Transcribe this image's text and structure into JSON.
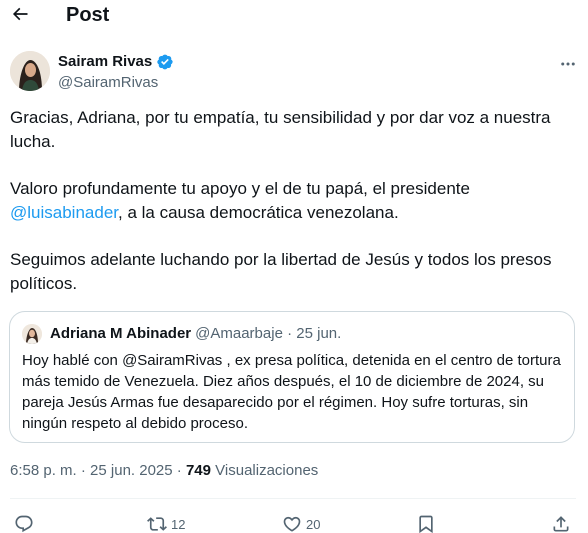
{
  "header": {
    "title": "Post"
  },
  "author": {
    "name": "Sairam Rivas",
    "handle": "@SairamRivas"
  },
  "tweet": {
    "p1": "Gracias, Adriana, por tu empatía, tu sensibilidad y por dar voz a nuestra lucha.",
    "p2_before": "Valoro profundamente tu apoyo y el de tu papá, el presidente ",
    "p2_mention": "@luisabinader",
    "p2_after": ", a la causa democrática venezolana.",
    "p3": "Seguimos adelante luchando por la libertad de Jesús y todos los presos políticos."
  },
  "quote": {
    "name": "Adriana M Abinader",
    "handle": "@Amaarbaje",
    "sep": " · ",
    "date": "25 jun.",
    "text": "Hoy hablé con @SairamRivas , ex presa política, detenida en el centro de tortura más temido de Venezuela. Diez años después, el 10 de diciembre de 2024, su pareja Jesús Armas fue desaparecido por el régimen. Hoy sufre torturas, sin ningún respeto al debido proceso."
  },
  "meta": {
    "time": "6:58 p. m.",
    "sep": " · ",
    "date": "25 jun. 2025",
    "views_count": "749",
    "views_label": " Visualizaciones"
  },
  "actions": {
    "reposts": "12",
    "likes": "20"
  },
  "colors": {
    "accent": "#1d9bf0",
    "secondary_text": "#536471",
    "border": "#cfd9de"
  }
}
